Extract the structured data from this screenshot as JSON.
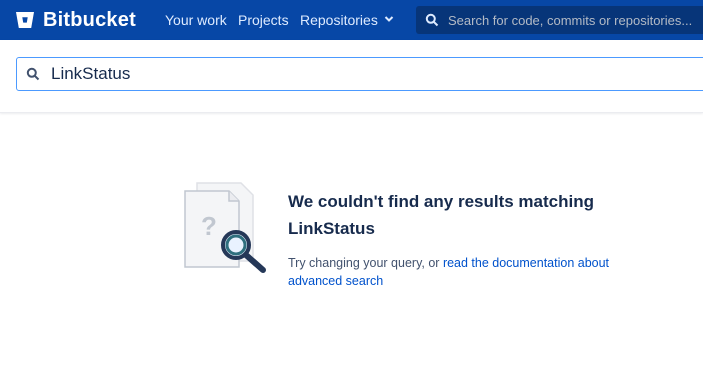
{
  "topbar": {
    "brand": "Bitbucket",
    "nav": [
      "Your work",
      "Projects",
      "Repositories"
    ],
    "search_placeholder": "Search for code, commits or repositories..."
  },
  "search": {
    "query": "LinkStatus"
  },
  "empty_state": {
    "heading": "We couldn't find any results matching",
    "query": "LinkStatus",
    "hint_prefix": "Try changing your query, or ",
    "hint_link": "read the documentation about advanced search"
  },
  "colors": {
    "topbar": "#0747a6",
    "link": "#0052cc",
    "focus_border": "#4c9aff",
    "illustration_accent": "#2e6f7e"
  },
  "icons": [
    "bitbucket-logo-icon",
    "chevron-down-icon",
    "search-icon",
    "no-results-magnifier-icon"
  ]
}
